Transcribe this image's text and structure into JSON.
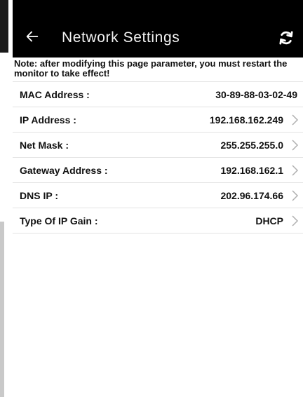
{
  "status_bar": {
    "left": "",
    "right": ""
  },
  "app_bar": {
    "title": "Network Settings",
    "back_icon": "arrow-back-icon",
    "refresh_icon": "refresh-icon"
  },
  "note": "Note: after modifying this page parameter, you must restart the monitor to take effect!",
  "rows": [
    {
      "label": "MAC Address :",
      "value": "30-89-88-03-02-49",
      "chevron": false
    },
    {
      "label": "IP Address :",
      "value": "192.168.162.249",
      "chevron": true
    },
    {
      "label": "Net Mask :",
      "value": "255.255.255.0",
      "chevron": true
    },
    {
      "label": "Gateway Address :",
      "value": "192.168.162.1",
      "chevron": true
    },
    {
      "label": "DNS IP :",
      "value": "202.96.174.66",
      "chevron": true
    },
    {
      "label": "Type Of IP Gain :",
      "value": "DHCP",
      "chevron": true
    }
  ],
  "colors": {
    "app_bar_bg": "#000000",
    "title_text": "#f2f2f2",
    "divider": "#e3e3e3",
    "chevron": "#b0b0b0"
  }
}
